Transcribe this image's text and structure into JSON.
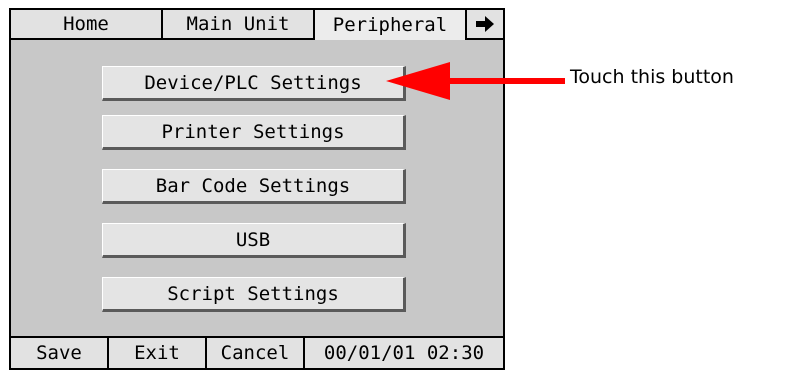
{
  "tabs": {
    "home": "Home",
    "main_unit": "Main Unit",
    "peripheral": "Peripheral",
    "next_icon": "arrow-right-icon"
  },
  "menu": {
    "device_plc": "Device/PLC Settings",
    "printer": "Printer Settings",
    "bar_code": "Bar Code Settings",
    "usb": "USB",
    "script": "Script Settings"
  },
  "statusbar": {
    "save": "Save",
    "exit": "Exit",
    "cancel": "Cancel",
    "datetime": "00/01/01 02:30"
  },
  "annotation": {
    "text": "Touch this button",
    "arrow_color": "#ff0000"
  }
}
